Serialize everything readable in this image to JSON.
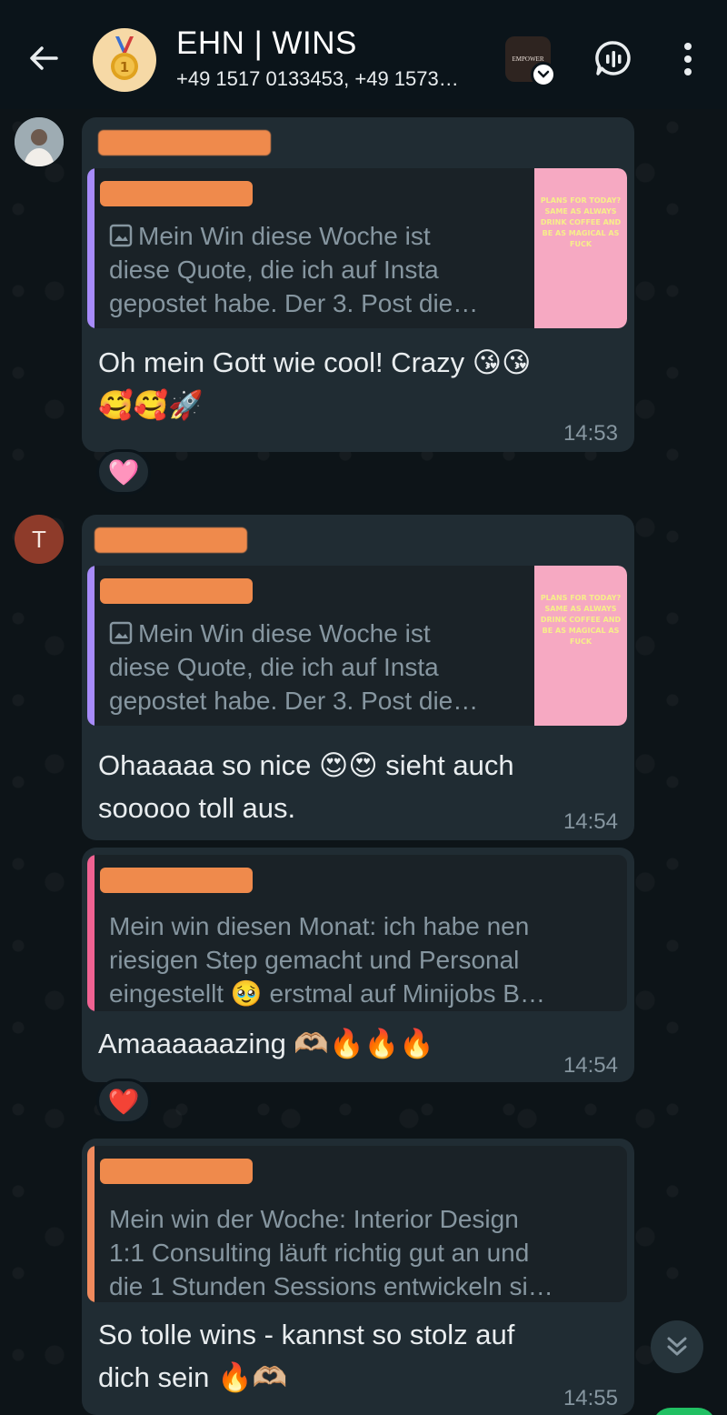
{
  "header": {
    "back_icon": "arrow-left-icon",
    "avatar_icon": "medal-icon",
    "title": "EHN | WINS",
    "subtitle": "+49 1517 0133453, +49 1573…",
    "community_label": "EMPOWER",
    "voice_icon": "voice-chat-icon",
    "menu_icon": "more-vert-icon"
  },
  "messages": [
    {
      "avatar": "photo-avatar",
      "quote_text": "Mein Win diese Woche ist\ndiese Quote, die ich auf Insta\ngepostet habe. Der 3. Post die…",
      "quote_color": "#a78bfa",
      "thumb_text": "PLANS FOR TODAY?\nSAME AS ALWAYS DRINK COFFEE AND BE AS MAGICAL AS FUCK",
      "text": "Oh mein Gott wie cool! Crazy 😘😘\n🥰🥰🚀",
      "time": "14:53",
      "reaction": "🩷"
    },
    {
      "avatar_letter": "T",
      "quote_text": "Mein Win diese Woche ist\ndiese Quote, die ich auf Insta\ngepostet habe. Der 3. Post die…",
      "quote_color": "#a78bfa",
      "thumb_text": "PLANS FOR TODAY?\nSAME AS ALWAYS DRINK COFFEE AND BE AS MAGICAL AS FUCK",
      "text": "Ohaaaaa so nice 😍😍 sieht auch\nsooooo toll aus.",
      "time": "14:54"
    },
    {
      "quote_text": "Mein win diesen Monat: ich habe nen\nriesigen Step gemacht und Personal\neingestellt 🥹 erstmal auf Minijobs B…",
      "quote_color": "#f06292",
      "text": "Amaaaaaazing 🫶🏼🔥🔥🔥",
      "time": "14:54",
      "reaction": "❤️"
    },
    {
      "quote_text": "Mein win der Woche: Interior Design\n1:1 Consulting läuft richtig gut an und\ndie 1 Stunden Sessions entwickeln si…",
      "quote_color": "#f08a5d",
      "text": "So tolle wins - kannst so stolz auf\ndich sein 🔥🫶🏼",
      "time": "14:55"
    }
  ],
  "scroll_icon": "double-chevron-down-icon"
}
